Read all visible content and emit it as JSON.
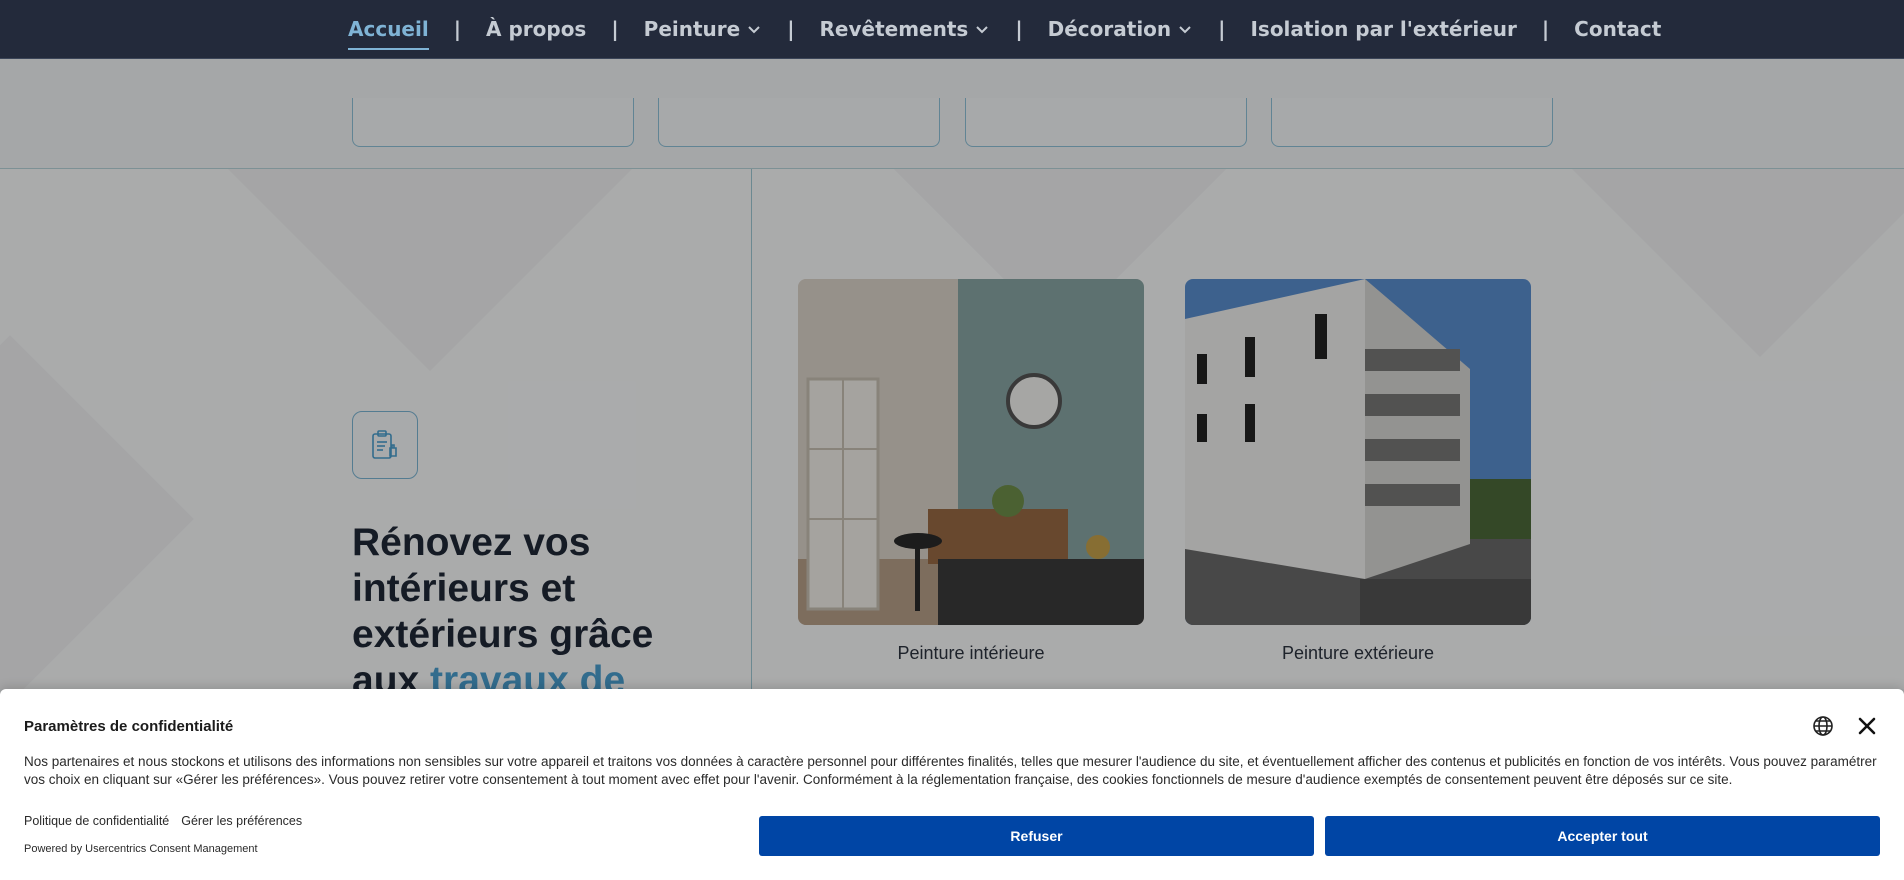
{
  "nav": {
    "items": [
      {
        "label": "Accueil",
        "active": true
      },
      {
        "label": "À propos"
      },
      {
        "label": "Peinture",
        "dropdown": true
      },
      {
        "label": "Revêtements",
        "dropdown": true
      },
      {
        "label": "Décoration",
        "dropdown": true
      },
      {
        "label": "Isolation par l'extérieur"
      },
      {
        "label": "Contact"
      }
    ],
    "separator": "|"
  },
  "hero": {
    "headline_part1": "Rénovez vos intérieurs et extérieurs grâce aux ",
    "headline_accent": "travaux de",
    "icon": "document-paint-icon"
  },
  "cards": [
    {
      "label": "Peinture intérieure"
    },
    {
      "label": "Peinture extérieure"
    }
  ],
  "consent": {
    "title": "Paramètres de confidentialité",
    "text": "Nos partenaires et nous stockons et utilisons des informations non sensibles sur votre appareil et traitons vos données à caractère personnel pour différentes finalités, telles que mesurer l'audience du site, et éventuellement afficher des contenus et publicités en fonction de vos intérêts. Vous pouvez paramétrer vos choix en cliquant sur «Gérer les préférences». Vous pouvez retirer votre consentement à tout moment avec effet pour l'avenir. Conformément à la réglementation française, des cookies fonctionnels de mesure d'audience exemptés de consentement peuvent être déposés sur ce site.",
    "link_privacy": "Politique de confidentialité",
    "link_prefs": "Gérer les préférences",
    "powered": "Powered by Usercentrics Consent Management",
    "refuse": "Refuser",
    "accept": "Accepter tout"
  },
  "colors": {
    "nav_bg": "#232a3b",
    "accent": "#4a9fd0",
    "button": "#0045a5"
  }
}
